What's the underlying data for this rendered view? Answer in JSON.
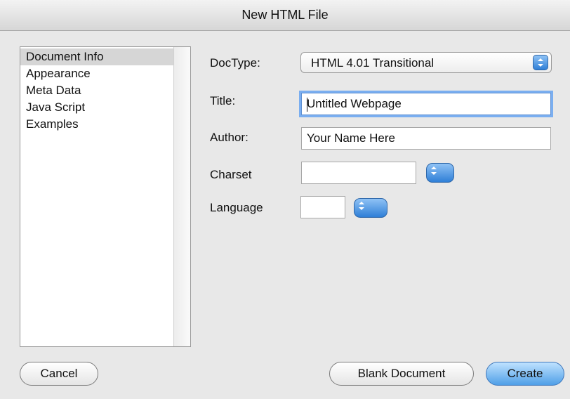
{
  "window": {
    "title": "New HTML File"
  },
  "sidebar": {
    "items": [
      {
        "label": "Document Info",
        "selected": true
      },
      {
        "label": "Appearance",
        "selected": false
      },
      {
        "label": "Meta Data",
        "selected": false
      },
      {
        "label": "Java Script",
        "selected": false
      },
      {
        "label": "Examples",
        "selected": false
      }
    ]
  },
  "form": {
    "doctype": {
      "label": "DocType:",
      "value": "HTML 4.01 Transitional"
    },
    "title": {
      "label": "Title:",
      "value": "Untitled Webpage"
    },
    "author": {
      "label": "Author:",
      "value": "Your Name Here"
    },
    "charset": {
      "label": "Charset",
      "value": ""
    },
    "language": {
      "label": "Language",
      "value": ""
    }
  },
  "buttons": {
    "cancel": "Cancel",
    "blank": "Blank Document",
    "create": "Create"
  }
}
